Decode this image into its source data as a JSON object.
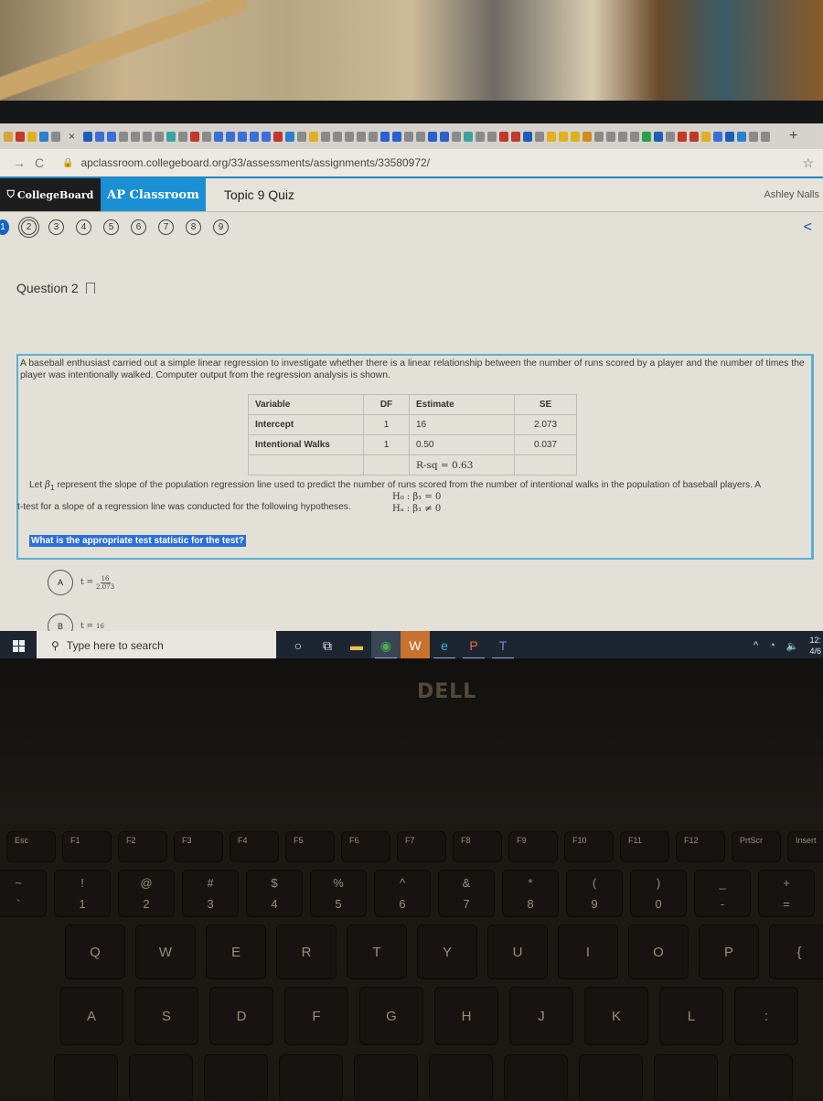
{
  "browser": {
    "tab_close": "×",
    "new_tab": "+",
    "favicon_colors": [
      "#d9a43a",
      "#c0392b",
      "#e0b020",
      "#2a7fd0",
      "#8a8a8a",
      "#1d5fb8",
      "#3b6fd8",
      "#3b6fd8",
      "#8a8a8a",
      "#8a8a8a",
      "#8a8a8a",
      "#8a8a8a",
      "#3aa3a0",
      "#8a8a8a",
      "#c0392b",
      "#8a8a8a",
      "#3b6fd8",
      "#3b6fd8",
      "#3b6fd8",
      "#3b6fd8",
      "#3b6fd8",
      "#c0392b",
      "#2a7fd0",
      "#8a8a8a",
      "#e0b020",
      "#8a8a8a",
      "#8a8a8a",
      "#8a8a8a",
      "#8a8a8a",
      "#8a8a8a",
      "#2a5fd0",
      "#2a5fd0",
      "#8a8a8a",
      "#8a8a8a",
      "#2a5fd0",
      "#2a5fd0",
      "#8a8a8a",
      "#3aa3a0",
      "#8a8a8a",
      "#8a8a8a",
      "#c0392b",
      "#c0392b",
      "#1d5fb8",
      "#8a8a8a",
      "#e0b020",
      "#e0b020",
      "#e0b020",
      "#d08a20",
      "#8a8a8a",
      "#8a8a8a",
      "#8a8a8a",
      "#8a8a8a",
      "#2aa04a",
      "#1d5fb8",
      "#8a8a8a",
      "#c0392b",
      "#c0392b",
      "#e0b020",
      "#3b6fd8",
      "#1d5fb8",
      "#2a7fd0",
      "#8a8a8a",
      "#8a8a8a"
    ],
    "back_icon": "→",
    "reload_icon": "C",
    "url": "apclassroom.collegeboard.org/33/assessments/assignments/33580972/",
    "bookmark_icon": "☆"
  },
  "app": {
    "brand": "CollegeBoard",
    "product": "AP Classroom",
    "quiz_title": "Topic 9 Quiz",
    "user_name": "Ashley Nalls",
    "question_numbers": [
      "1",
      "2",
      "3",
      "4",
      "5",
      "6",
      "7",
      "8",
      "9"
    ],
    "current_question": "2",
    "completed_questions": [
      "1"
    ],
    "back_icon": "<"
  },
  "question": {
    "title": "Question 2",
    "stem": "A baseball enthusiast carried out a simple linear regression to investigate whether there is a linear relationship between the number of runs scored by a player and the number of times the player was intentionally walked. Computer output from the regression analysis is shown.",
    "table": {
      "headers": [
        "Variable",
        "DF",
        "Estimate",
        "SE"
      ],
      "rows": [
        [
          "Intercept",
          "1",
          "16",
          "2.073"
        ],
        [
          "Intentional Walks",
          "1",
          "0.50",
          "0.037"
        ],
        [
          "",
          "",
          "R-sq = 0.63",
          ""
        ]
      ]
    },
    "beta_prefix": "Let",
    "beta_symbol": "β",
    "beta_sub": "1",
    "beta_text": "represent the slope of the population regression line used to predict the number of runs scored from the number of intentional walks in the population of baseball players. A",
    "ttest_text": "t-test for a slope of a regression line was conducted for the following hypotheses.",
    "h0": "H₀ : β₁ = 0",
    "ha": "Hₐ : β₁ ≠ 0",
    "prompt": "What is the appropriate test statistic for the test?",
    "choices": [
      {
        "letter": "A",
        "lhs": "t =",
        "numerator": "16",
        "denominator": "2.073"
      },
      {
        "letter": "B",
        "lhs": "t =",
        "numerator": "16",
        "denominator": ""
      }
    ]
  },
  "taskbar": {
    "search_placeholder": "Type here to search",
    "apps": [
      {
        "name": "cortana",
        "glyph": "○",
        "active": false
      },
      {
        "name": "task-view",
        "glyph": "⧉",
        "active": false
      },
      {
        "name": "file-explorer",
        "glyph": "▬",
        "active": false
      },
      {
        "name": "chrome",
        "glyph": "◉",
        "active": true
      },
      {
        "name": "word",
        "glyph": "W",
        "active": false
      },
      {
        "name": "edge",
        "glyph": "e",
        "active": true
      },
      {
        "name": "powerpoint",
        "glyph": "P",
        "active": true
      },
      {
        "name": "teams",
        "glyph": "T",
        "active": true
      }
    ],
    "tray_chevron": "^",
    "clock_time": "12:",
    "clock_date": "4/6"
  },
  "laptop": {
    "brand": "DELL"
  },
  "keyboard": {
    "fn_row": [
      "Esc",
      "F1",
      "F2",
      "F3",
      "F4",
      "F5",
      "F6",
      "F7",
      "F8",
      "F9",
      "F10",
      "F11",
      "F12",
      "PrtScr",
      "Insert"
    ],
    "num_row_shift": [
      "~",
      "!",
      "@",
      "#",
      "$",
      "%",
      "^",
      "&",
      "*",
      "(",
      ")",
      "_",
      "+"
    ],
    "num_row_base": [
      "`",
      "1",
      "2",
      "3",
      "4",
      "5",
      "6",
      "7",
      "8",
      "9",
      "0",
      "-",
      "="
    ],
    "row_q": [
      "Q",
      "W",
      "E",
      "R",
      "T",
      "Y",
      "U",
      "I",
      "O",
      "P",
      "{"
    ],
    "row_a": [
      "A",
      "S",
      "D",
      "F",
      "G",
      "H",
      "J",
      "K",
      "L",
      ":"
    ]
  }
}
